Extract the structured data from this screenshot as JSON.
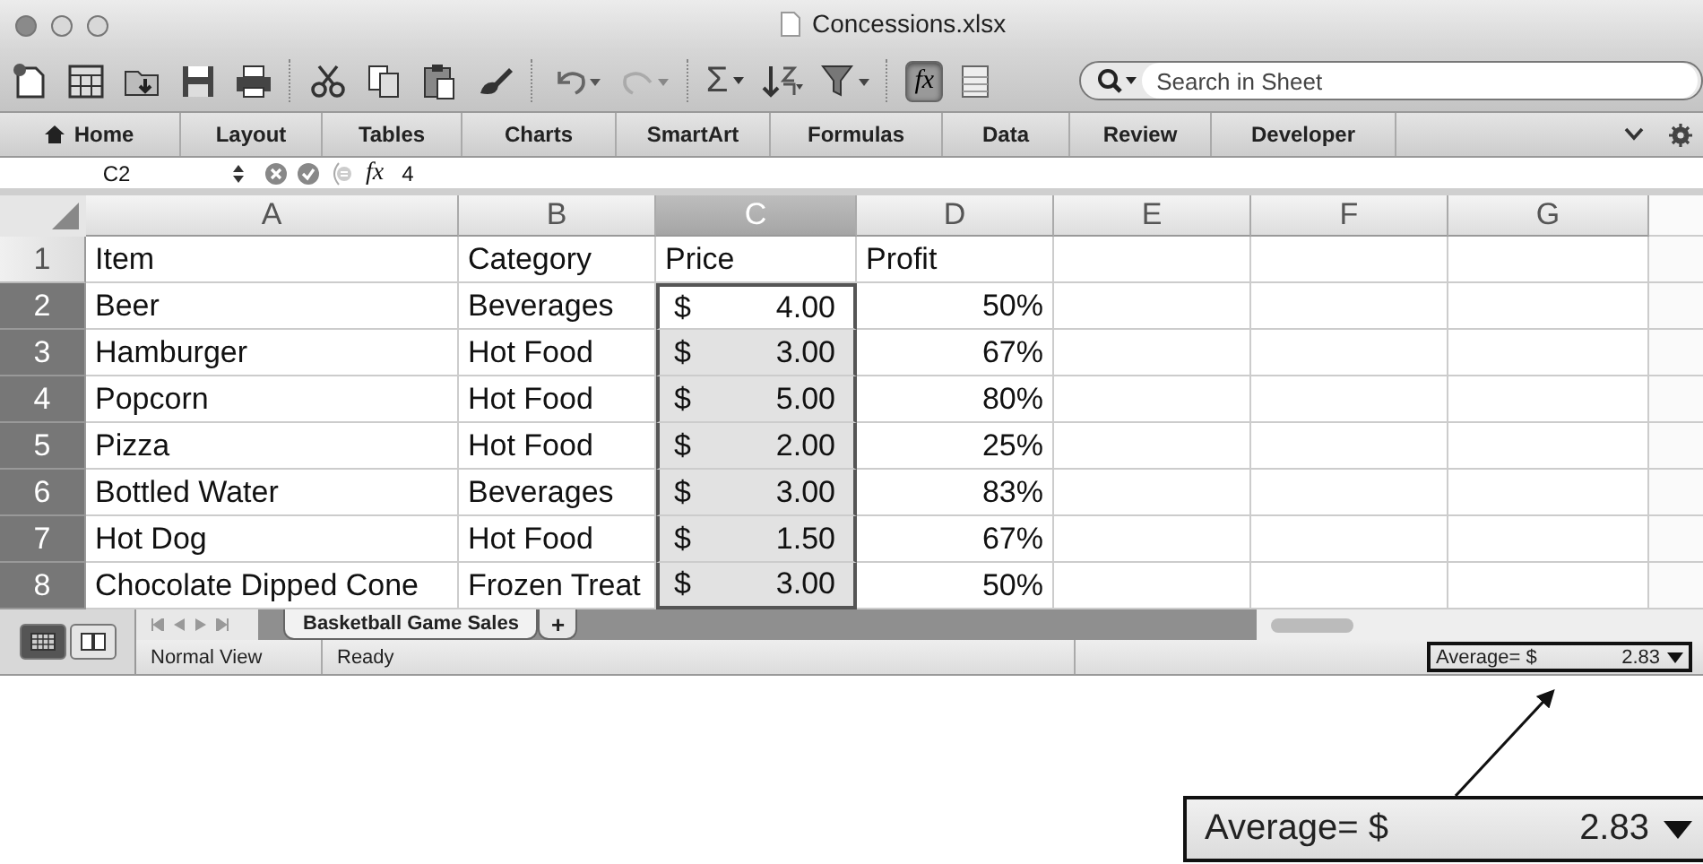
{
  "window": {
    "title": "Concessions.xlsx"
  },
  "toolbar": {
    "sum_label": "Σ",
    "fx_label": "fx",
    "fx_pressed": true
  },
  "search": {
    "placeholder": "Search in Sheet"
  },
  "ribbon_tabs": [
    {
      "label": "Home",
      "selected": false
    },
    {
      "label": "Layout",
      "selected": false
    },
    {
      "label": "Tables",
      "selected": false
    },
    {
      "label": "Charts",
      "selected": false
    },
    {
      "label": "SmartArt",
      "selected": false
    },
    {
      "label": "Formulas",
      "selected": false
    },
    {
      "label": "Data",
      "selected": false
    },
    {
      "label": "Review",
      "selected": false
    },
    {
      "label": "Developer",
      "selected": false
    }
  ],
  "formula_bar": {
    "name_box": "C2",
    "fx": "fx",
    "value": "4"
  },
  "columns": [
    {
      "label": "A",
      "selected": false
    },
    {
      "label": "B",
      "selected": false
    },
    {
      "label": "C",
      "selected": true
    },
    {
      "label": "D",
      "selected": false
    },
    {
      "label": "E",
      "selected": false
    },
    {
      "label": "F",
      "selected": false
    },
    {
      "label": "G",
      "selected": false
    }
  ],
  "rows": [
    {
      "number": "1",
      "selected": false,
      "cells": [
        {
          "kind": "text",
          "text": "Item",
          "selected": false
        },
        {
          "kind": "text",
          "text": "Category",
          "selected": false
        },
        {
          "kind": "text",
          "text": "Price",
          "selected": false
        },
        {
          "kind": "text",
          "text": "Profit",
          "selected": false
        }
      ]
    },
    {
      "number": "2",
      "selected": true,
      "cells": [
        {
          "kind": "text",
          "text": "Beer",
          "selected": false
        },
        {
          "kind": "text",
          "text": "Beverages",
          "selected": false
        },
        {
          "kind": "currency",
          "symbol": "$",
          "text": "4.00",
          "selected": true,
          "active": true
        },
        {
          "kind": "number",
          "text": "50%",
          "selected": false
        }
      ]
    },
    {
      "number": "3",
      "selected": true,
      "cells": [
        {
          "kind": "text",
          "text": "Hamburger",
          "selected": false
        },
        {
          "kind": "text",
          "text": "Hot Food",
          "selected": false
        },
        {
          "kind": "currency",
          "symbol": "$",
          "text": "3.00",
          "selected": true,
          "active": false
        },
        {
          "kind": "number",
          "text": "67%",
          "selected": false
        }
      ]
    },
    {
      "number": "4",
      "selected": true,
      "cells": [
        {
          "kind": "text",
          "text": "Popcorn",
          "selected": false
        },
        {
          "kind": "text",
          "text": "Hot Food",
          "selected": false
        },
        {
          "kind": "currency",
          "symbol": "$",
          "text": "5.00",
          "selected": true,
          "active": false
        },
        {
          "kind": "number",
          "text": "80%",
          "selected": false
        }
      ]
    },
    {
      "number": "5",
      "selected": true,
      "cells": [
        {
          "kind": "text",
          "text": "Pizza",
          "selected": false
        },
        {
          "kind": "text",
          "text": "Hot Food",
          "selected": false
        },
        {
          "kind": "currency",
          "symbol": "$",
          "text": "2.00",
          "selected": true,
          "active": false
        },
        {
          "kind": "number",
          "text": "25%",
          "selected": false
        }
      ]
    },
    {
      "number": "6",
      "selected": true,
      "cells": [
        {
          "kind": "text",
          "text": "Bottled Water",
          "selected": false
        },
        {
          "kind": "text",
          "text": "Beverages",
          "selected": false
        },
        {
          "kind": "currency",
          "symbol": "$",
          "text": "3.00",
          "selected": true,
          "active": false
        },
        {
          "kind": "number",
          "text": "83%",
          "selected": false
        }
      ]
    },
    {
      "number": "7",
      "selected": true,
      "cells": [
        {
          "kind": "text",
          "text": "Hot Dog",
          "selected": false
        },
        {
          "kind": "text",
          "text": "Hot Food",
          "selected": false
        },
        {
          "kind": "currency",
          "symbol": "$",
          "text": "1.50",
          "selected": true,
          "active": false
        },
        {
          "kind": "number",
          "text": "67%",
          "selected": false
        }
      ]
    },
    {
      "number": "8",
      "selected": true,
      "cells": [
        {
          "kind": "text",
          "text": "Chocolate Dipped Cone",
          "selected": false
        },
        {
          "kind": "text",
          "text": "Frozen Treat",
          "selected": false
        },
        {
          "kind": "currency",
          "symbol": "$",
          "text": "3.00",
          "selected": true,
          "active": false
        },
        {
          "kind": "number",
          "text": "50%",
          "selected": false
        }
      ]
    }
  ],
  "view_buttons": [
    {
      "selected": true
    },
    {
      "selected": false
    }
  ],
  "sheet_tabs": [
    {
      "label": "Basketball Game Sales",
      "selected": true
    }
  ],
  "add_sheet": "+",
  "status_bar": {
    "view": "Normal View",
    "state": "Ready",
    "summary_label": "Average= $",
    "summary_value": "2.83"
  },
  "callout": {
    "label": "Average= $",
    "value": "2.83"
  }
}
